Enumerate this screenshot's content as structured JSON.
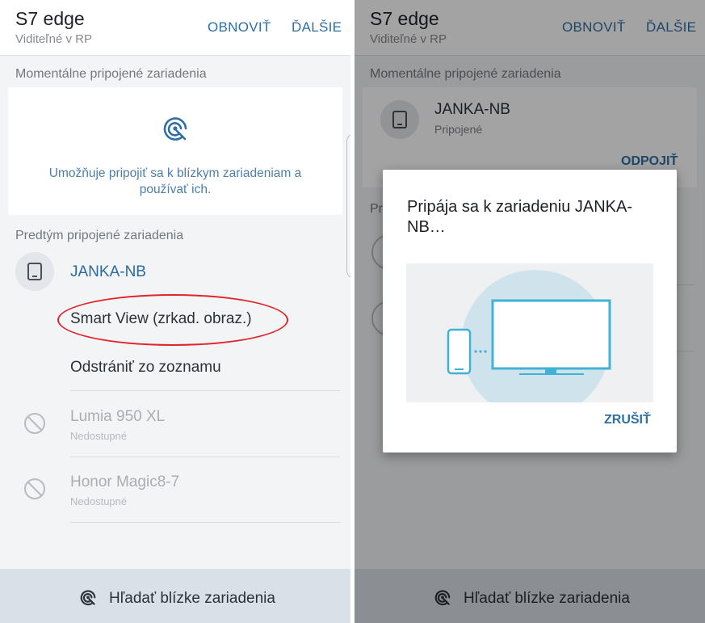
{
  "left": {
    "header": {
      "title": "S7 edge",
      "subtitle": "Viditeľné v RP",
      "refresh": "OBNOVIŤ",
      "more": "ĎALŠIE"
    },
    "current_section": "Momentálne pripojené zariadenia",
    "empty_text": "Umožňuje pripojiť sa k blízkym zariadeniam a používať ich.",
    "previous_section": "Predtým pripojené zariadenia",
    "devices": [
      {
        "name": "JANKA-NB",
        "menu": [
          "Smart View (zrkad. obraz.)",
          "Odstrániť zo zoznamu"
        ]
      },
      {
        "name": "Lumia 950 XL",
        "status": "Nedostupné"
      },
      {
        "name": "Honor Magic8-7",
        "status": "Nedostupné"
      }
    ],
    "bottom_button": "Hľadať blízke zariadenia"
  },
  "right": {
    "header": {
      "title": "S7 edge",
      "subtitle": "Viditeľné v RP",
      "refresh": "OBNOVIŤ",
      "more": "ĎALŠIE"
    },
    "current_section": "Momentálne pripojené zariadenia",
    "connected": {
      "name": "JANKA-NB",
      "status": "Pripojené",
      "disconnect": "ODPOJIŤ"
    },
    "previous_section_partial": "Pr",
    "dialog": {
      "title": "Pripája sa k zariadeniu JANKA-NB…",
      "cancel": "ZRUŠIŤ"
    },
    "bottom_button": "Hľadať blízke zariadenia"
  },
  "colors": {
    "accent": "#2f6fa3",
    "annotation": "#e0242a",
    "illustration": "#3fb2d6"
  },
  "icons": {
    "scan": "nearby-scan-icon",
    "tablet": "tablet-icon",
    "unavailable": "ban-icon"
  }
}
